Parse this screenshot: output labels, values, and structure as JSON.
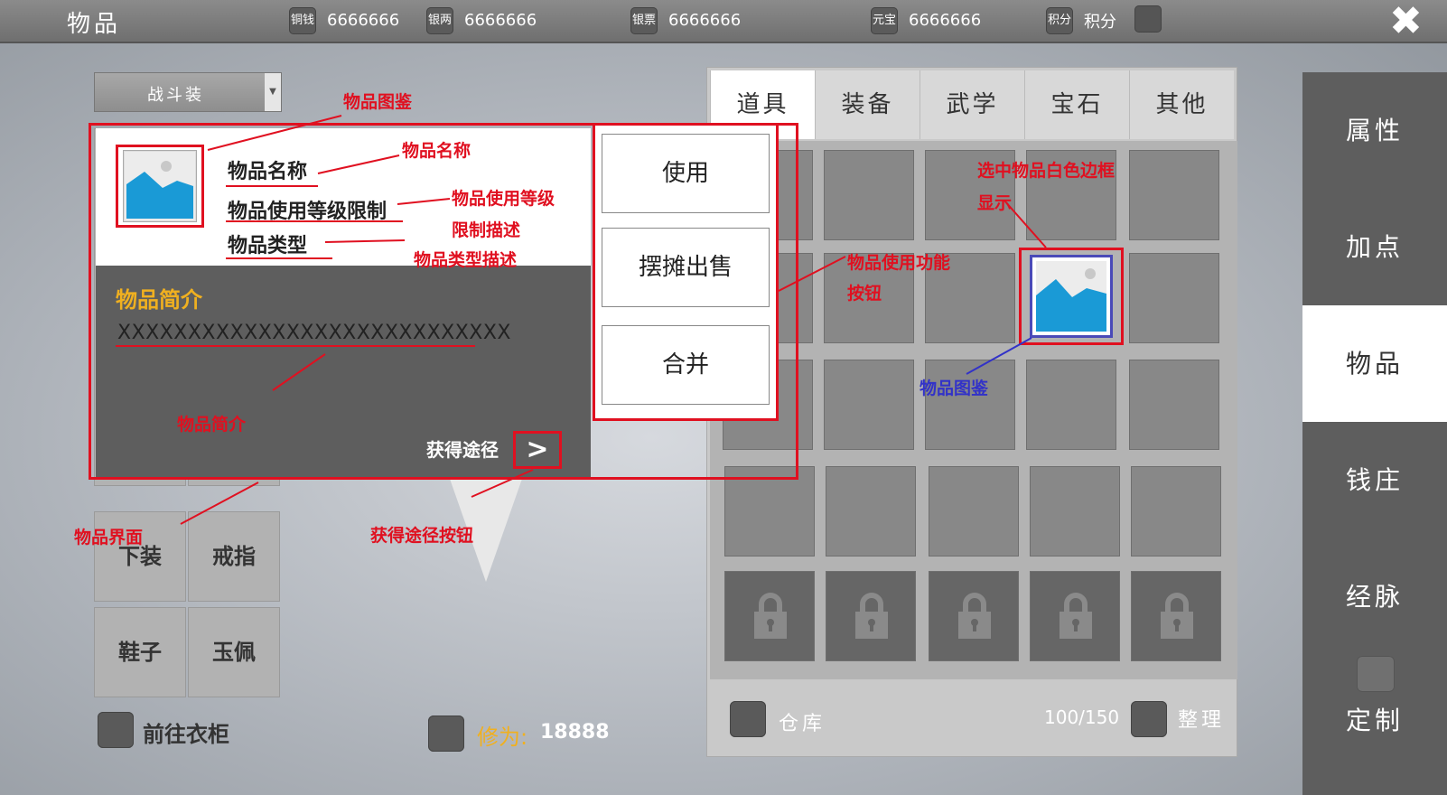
{
  "header": {
    "title": "物品",
    "currencies": [
      {
        "label": "铜钱",
        "value": "6666666"
      },
      {
        "label": "银两",
        "value": "6666666"
      },
      {
        "label": "银票",
        "value": "6666666"
      },
      {
        "label": "元宝",
        "value": "6666666"
      },
      {
        "label": "积分",
        "value": "积分"
      }
    ],
    "close_label": "✖"
  },
  "sidebar": {
    "items": [
      {
        "label": "属性",
        "active": false
      },
      {
        "label": "加点",
        "active": false
      },
      {
        "label": "物品",
        "active": true
      },
      {
        "label": "钱庄",
        "active": false
      },
      {
        "label": "经脉",
        "active": false
      },
      {
        "label": "定制",
        "active": false
      }
    ]
  },
  "equip": {
    "dropdown_value": "战斗装",
    "slots": [
      "下装",
      "戒指",
      "鞋子",
      "玉佩"
    ],
    "wardrobe_label": "前往衣柜"
  },
  "popup": {
    "item_name": "物品名称",
    "item_level": "物品使用等级限制",
    "item_type": "物品类型",
    "intro_title": "物品简介",
    "intro_text": "XXXXXXXXXXXXXXXXXXXXXXXXXXXX",
    "obtain_label": "获得途径",
    "obtain_icon": ">",
    "actions": [
      "使用",
      "摆摊出售",
      "合并"
    ]
  },
  "annotations": {
    "icon": "物品图鉴",
    "name": "物品名称",
    "level_1": "物品使用等级",
    "level_2": "限制描述",
    "type": "物品类型描述",
    "intro": "物品简介",
    "ui": "物品界面",
    "obtain_btn": "获得途径按钮",
    "func_1": "物品使用功能",
    "func_2": "按钮",
    "selected_1": "选中物品白色边框",
    "selected_2": "显示",
    "icon_blue": "物品图鉴"
  },
  "inventory": {
    "tabs": [
      {
        "label": "道具",
        "active": true
      },
      {
        "label": "装备",
        "active": false
      },
      {
        "label": "武学",
        "active": false
      },
      {
        "label": "宝石",
        "active": false
      },
      {
        "label": "其他",
        "active": false
      }
    ],
    "warehouse_label": "仓库",
    "capacity": "100/150",
    "sort_label": "整理"
  },
  "cultivation": {
    "label": "修为:",
    "value": "18888"
  },
  "colors": {
    "annotation": "#e01020",
    "annotation_blue": "#3232c8",
    "gold": "#f0b020",
    "picture_sky": "#1a9ad6"
  }
}
